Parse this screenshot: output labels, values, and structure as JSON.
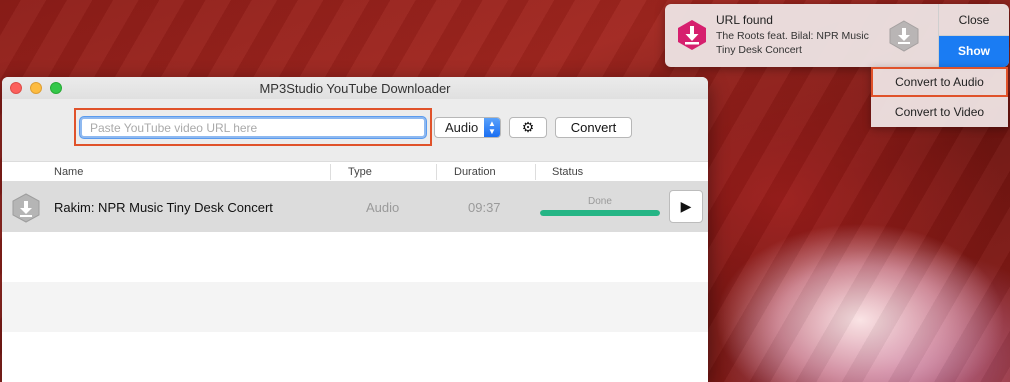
{
  "window": {
    "title": "MP3Studio YouTube Downloader"
  },
  "toolbar": {
    "url_placeholder": "Paste YouTube video URL here",
    "url_value": "",
    "format_selected": "Audio",
    "format_arrows": "▲▼",
    "gear_icon": "⚙",
    "convert_label": "Convert"
  },
  "table": {
    "headers": [
      "Name",
      "Type",
      "Duration",
      "Status"
    ],
    "rows": [
      {
        "name": "Rakim: NPR Music Tiny Desk Concert",
        "type": "Audio",
        "duration": "09:37",
        "status": "Done",
        "progress": 1.0,
        "play_icon": "▶"
      }
    ]
  },
  "notification": {
    "title": "URL found",
    "body": "The Roots feat. Bilal: NPR Music Tiny Desk Concert",
    "close_label": "Close",
    "show_label": "Show"
  },
  "dropdown": {
    "items": [
      "Convert to Audio",
      "Convert to Video"
    ]
  },
  "colors": {
    "accent_blue": "#1a7cf3",
    "highlight_orange": "#e0522a",
    "progress_green": "#25b585",
    "app_icon_pink": "#d61f6e"
  }
}
